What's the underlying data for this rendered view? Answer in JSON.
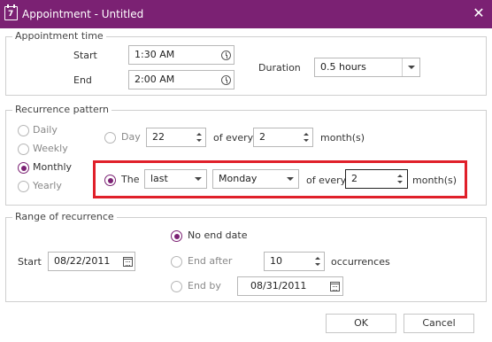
{
  "window": {
    "title": "Appointment - Untitled",
    "app_icon_text": "7",
    "close_glyph": "✕"
  },
  "appointment_time": {
    "legend": "Appointment time",
    "start_label": "Start",
    "start_value": "1:30 AM",
    "end_label": "End",
    "end_value": "2:00 AM",
    "duration_label": "Duration",
    "duration_value": "0.5 hours"
  },
  "recurrence_pattern": {
    "legend": "Recurrence pattern",
    "frequencies": [
      "Daily",
      "Weekly",
      "Monthly",
      "Yearly"
    ],
    "selected_frequency": "Monthly",
    "day_option": {
      "label": "Day",
      "day_value": "22",
      "of_every_label": "of every",
      "every_value": "2",
      "unit_label": "month(s)"
    },
    "the_option": {
      "label": "The",
      "ordinal_value": "last",
      "weekday_value": "Monday",
      "of_every_label": "of every",
      "every_value": "2",
      "unit_label": "month(s)",
      "selected": true
    }
  },
  "range_of_recurrence": {
    "legend": "Range of recurrence",
    "start_label": "Start",
    "start_value": "08/22/2011",
    "no_end_label": "No end date",
    "end_after_label": "End after",
    "occurrences_value": "10",
    "occurrences_label": "occurrences",
    "end_by_label": "End by",
    "end_by_value": "08/31/2011",
    "selected": "No end date"
  },
  "buttons": {
    "ok": "OK",
    "cancel": "Cancel"
  },
  "colors": {
    "accent": "#7b2173",
    "highlight": "#e0202a"
  },
  "icons": {
    "app": "calendar-icon",
    "close": "close-icon",
    "time": "clock-icon",
    "date": "calendar-icon"
  }
}
